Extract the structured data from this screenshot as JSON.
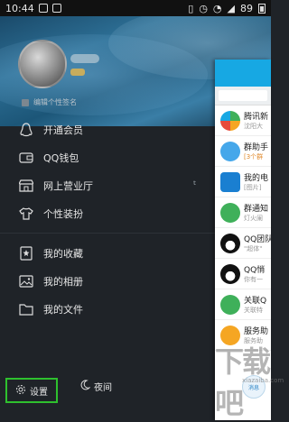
{
  "status_bar": {
    "time": "10:44",
    "battery": "89"
  },
  "signature": {
    "label": "编辑个性签名"
  },
  "menu": [
    {
      "label": "开通会员",
      "icon": "penguin-icon"
    },
    {
      "label": "QQ钱包",
      "icon": "wallet-icon"
    },
    {
      "label": "网上营业厅",
      "icon": "store-icon",
      "badge_icon": "telecom-logo-icon"
    },
    {
      "label": "个性装扮",
      "icon": "tshirt-icon"
    },
    {
      "label": "我的收藏",
      "icon": "star-bookmark-icon"
    },
    {
      "label": "我的相册",
      "icon": "photo-icon"
    },
    {
      "label": "我的文件",
      "icon": "folder-icon"
    }
  ],
  "bottom": {
    "settings_label": "设置",
    "night_label": "夜间"
  },
  "chat_list": [
    {
      "title": "腾讯新",
      "sub": "沈阳大",
      "color": "#f2f2f2"
    },
    {
      "title": "群助手",
      "sub": "[3个群",
      "color": "#45a7ea"
    },
    {
      "title": "我的电",
      "sub": "[图片]",
      "color": "#1a7fd1"
    },
    {
      "title": "群通知",
      "sub": "灯火阑",
      "color": "#3fb05a"
    },
    {
      "title": "QQ团队",
      "sub": "\"超体\"",
      "color": "#111111"
    },
    {
      "title": "QQ悄",
      "sub": "你有一",
      "color": "#111111"
    },
    {
      "title": "关联Q",
      "sub": "关联特",
      "color": "#3fb05a"
    },
    {
      "title": "服务助",
      "sub": "服务助",
      "color": "#f5a623"
    }
  ],
  "float_button": {
    "label": "消息"
  },
  "watermark": {
    "text": "下载吧",
    "small": "xiazaiba.com"
  }
}
